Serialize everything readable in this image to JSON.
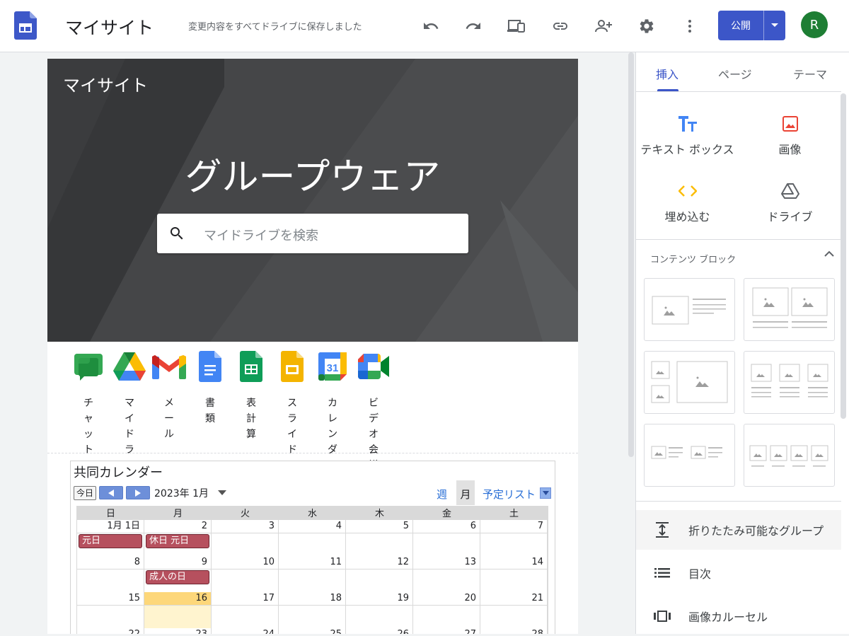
{
  "topbar": {
    "site_title": "マイサイト",
    "save_status": "変更内容をすべてドライブに保存しました",
    "publish_label": "公開",
    "avatar_initial": "R",
    "icons": [
      "undo-icon",
      "redo-icon",
      "preview-icon",
      "link-icon",
      "share-icon",
      "settings-icon",
      "more-icon"
    ]
  },
  "hero": {
    "site_name": "マイサイト",
    "title": "グループウェア",
    "search_placeholder": "マイドライブを検索"
  },
  "apps": [
    {
      "label": "チャット",
      "icon": "google-chat-icon"
    },
    {
      "label": "マイドライブ",
      "icon": "google-drive-icon"
    },
    {
      "label": "メール",
      "icon": "gmail-icon"
    },
    {
      "label": "書類",
      "icon": "google-docs-icon"
    },
    {
      "label": "表計算",
      "icon": "google-sheets-icon"
    },
    {
      "label": "スライド",
      "icon": "google-slides-icon"
    },
    {
      "label": "カレンダー",
      "icon": "google-calendar-icon"
    },
    {
      "label": "ビデオ会議",
      "icon": "google-meet-icon"
    }
  ],
  "calendar": {
    "title": "共同カレンダー",
    "today_label": "今日",
    "month_label": "2023年 1月",
    "week_tab": "週",
    "month_tab": "月",
    "agenda_tab": "予定リスト",
    "weekdays": [
      "日",
      "月",
      "火",
      "水",
      "木",
      "金",
      "土"
    ],
    "weeks": [
      [
        "1月 1日",
        "2",
        "3",
        "4",
        "5",
        "6",
        "7"
      ],
      [
        "8",
        "9",
        "10",
        "11",
        "12",
        "13",
        "14"
      ],
      [
        "15",
        "16",
        "17",
        "18",
        "19",
        "20",
        "21"
      ],
      [
        "22",
        "23",
        "24",
        "25",
        "26",
        "27",
        "28"
      ]
    ],
    "highlight": {
      "week": 2,
      "day": 1
    },
    "events": [
      {
        "week": 0,
        "day": 0,
        "label": "元日"
      },
      {
        "week": 0,
        "day": 1,
        "label": "休日 元日"
      },
      {
        "week": 1,
        "day": 1,
        "label": "成人の日"
      }
    ]
  },
  "panel": {
    "tabs": [
      "挿入",
      "ページ",
      "テーマ"
    ],
    "insert_items": [
      {
        "label": "テキスト ボックス",
        "icon": "text-box-icon"
      },
      {
        "label": "画像",
        "icon": "image-icon"
      },
      {
        "label": "埋め込む",
        "icon": "embed-icon"
      },
      {
        "label": "ドライブ",
        "icon": "drive-icon"
      }
    ],
    "content_blocks_title": "コンテンツ ブロック",
    "features": [
      {
        "label": "折りたたみ可能なグループ",
        "icon": "collapsible-group-icon"
      },
      {
        "label": "目次",
        "icon": "table-of-contents-icon"
      },
      {
        "label": "画像カルーセル",
        "icon": "image-carousel-icon"
      }
    ]
  },
  "colors": {
    "accent": "#3c56c8",
    "hero_bg": "#3f4042",
    "event": "#b6505e",
    "today_highlight": "#fdd77a"
  }
}
